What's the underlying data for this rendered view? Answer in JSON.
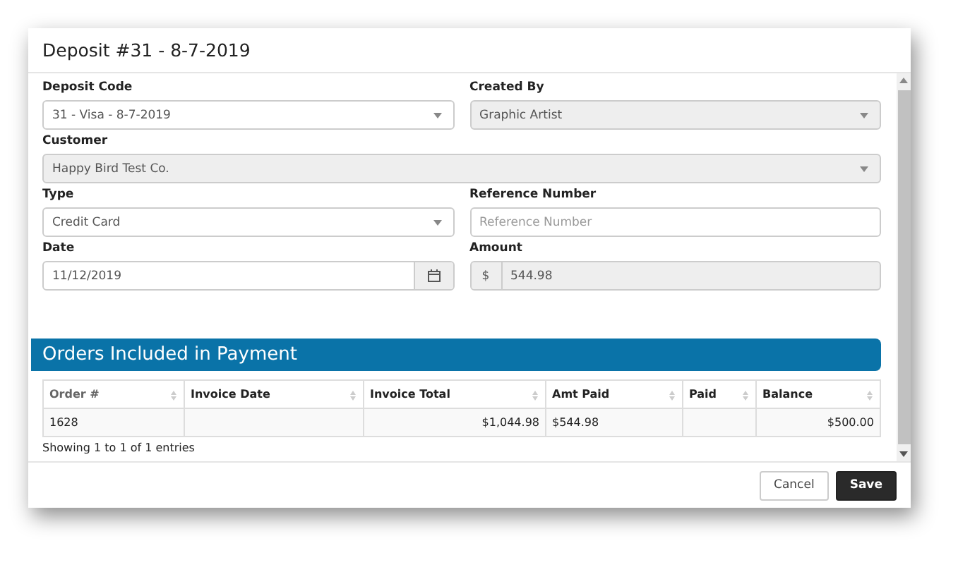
{
  "dialog": {
    "title": "Deposit #31 - 8-7-2019"
  },
  "field_rows": [
    [
      {
        "label": "Deposit Code",
        "kind": "select",
        "value": "31 - Visa - 8-7-2019",
        "disabled": false
      },
      {
        "label": "Created By",
        "kind": "select",
        "value": "Graphic Artist",
        "disabled": true
      }
    ],
    [
      {
        "label": "Customer",
        "kind": "select",
        "value": "Happy Bird Test Co.",
        "disabled": true
      }
    ],
    [
      {
        "label": "Type",
        "kind": "select",
        "value": "Credit Card",
        "disabled": false
      },
      {
        "label": "Reference Number",
        "kind": "text",
        "placeholder": "Reference Number",
        "disabled": false
      }
    ],
    [
      {
        "label": "Date",
        "kind": "date",
        "value": "11/12/2019",
        "disabled": false
      },
      {
        "label": "Amount",
        "kind": "amount",
        "prefix": "$",
        "value": "544.98",
        "disabled": true
      }
    ]
  ],
  "orders": {
    "title": "Orders Included in Payment",
    "columns": [
      {
        "label": "Order #",
        "muted": true
      },
      {
        "label": "Invoice Date",
        "muted": false
      },
      {
        "label": "Invoice Total",
        "muted": false
      },
      {
        "label": "Amt Paid",
        "muted": false
      },
      {
        "label": "Paid",
        "muted": false
      },
      {
        "label": "Balance",
        "muted": false
      }
    ],
    "rows": [
      {
        "cells": [
          "1628",
          "",
          "$1,044.98",
          "$544.98",
          "",
          "$500.00"
        ]
      }
    ],
    "info": "Showing 1 to 1 of 1 entries"
  },
  "buttons": [
    {
      "label": "Cancel",
      "kind": "default"
    },
    {
      "label": "Save",
      "kind": "primary"
    }
  ]
}
